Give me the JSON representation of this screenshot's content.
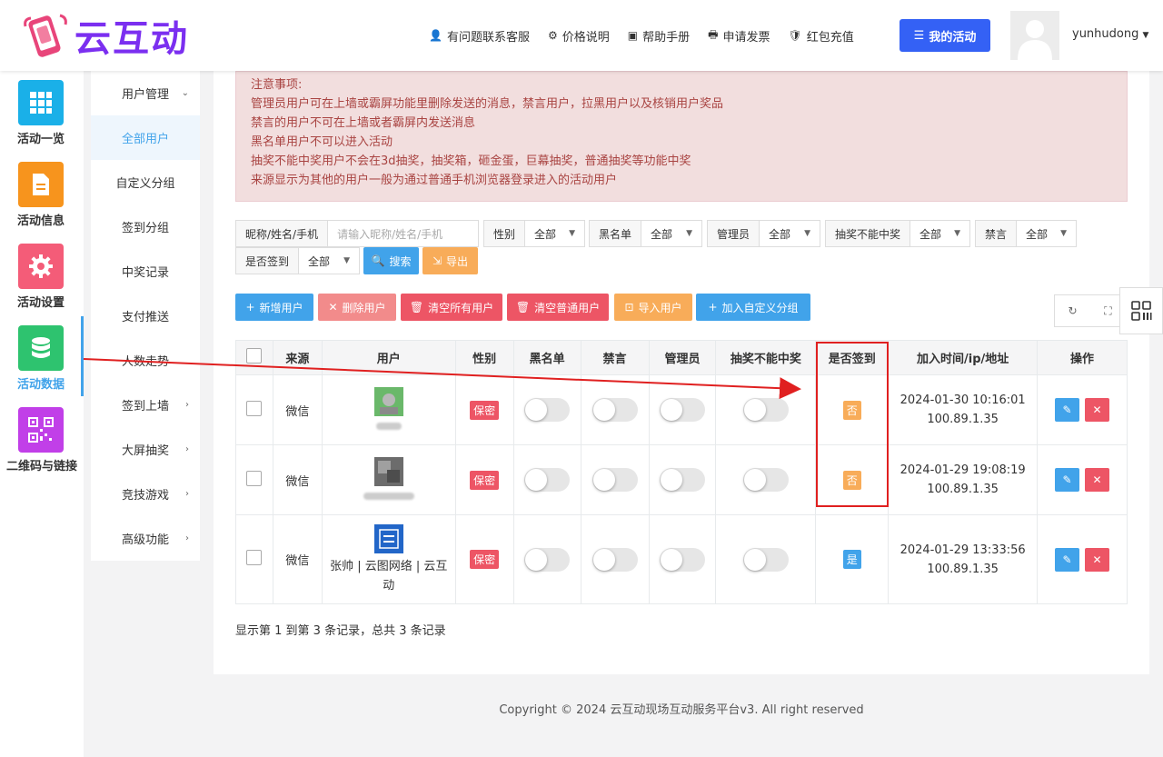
{
  "brand": {
    "name": "云互动"
  },
  "topnav": [
    {
      "icon": "user-plus-icon",
      "label": "有问题联系客服"
    },
    {
      "icon": "gear-icon",
      "label": "价格说明"
    },
    {
      "icon": "book-icon",
      "label": "帮助手册"
    },
    {
      "icon": "printer-icon",
      "label": "申请发票"
    },
    {
      "icon": "shield-check-icon",
      "label": "红包充值"
    }
  ],
  "my_activity": "我的活动",
  "username": "yunhudong",
  "leftbar": [
    {
      "label": "活动一览",
      "icon": "grid-icon",
      "color": "#1ab0e8"
    },
    {
      "label": "活动信息",
      "icon": "document-icon",
      "color": "#f7941d"
    },
    {
      "label": "活动设置",
      "icon": "gear-icon",
      "color": "#f45c78"
    },
    {
      "label": "活动数据",
      "icon": "database-icon",
      "color": "#2ec36f"
    },
    {
      "label": "二维码与链接",
      "icon": "qrcode-icon",
      "color": "#c13fe8"
    }
  ],
  "subnav": [
    {
      "label": "用户管理",
      "chev": "⌄"
    },
    {
      "label": "全部用户",
      "chev": ""
    },
    {
      "label": "自定义分组",
      "chev": ""
    },
    {
      "label": "签到分组",
      "chev": ""
    },
    {
      "label": "中奖记录",
      "chev": ""
    },
    {
      "label": "支付推送",
      "chev": ""
    },
    {
      "label": "人数走势",
      "chev": ""
    },
    {
      "label": "签到上墙",
      "chev": "›"
    },
    {
      "label": "大屏抽奖",
      "chev": "›"
    },
    {
      "label": "竞技游戏",
      "chev": "›"
    },
    {
      "label": "高级功能",
      "chev": "›"
    }
  ],
  "notice": [
    "注意事项:",
    "管理员用户可在上墙或霸屏功能里删除发送的消息，禁言用户，拉黑用户以及核销用户奖品",
    "禁言的用户不可在上墙或者霸屏内发送消息",
    "黑名单用户不可以进入活动",
    "抽奖不能中奖用户不会在3d抽奖，抽奖箱，砸金蛋，巨幕抽奖，普通抽奖等功能中奖",
    "来源显示为其他的用户一般为通过普通手机浏览器登录进入的活动用户"
  ],
  "filters": {
    "search_label": "昵称/姓名/手机",
    "search_placeholder": "请输入昵称/姓名/手机",
    "gender_label": "性别",
    "blacklist_label": "黑名单",
    "admin_label": "管理员",
    "nowin_label": "抽奖不能中奖",
    "mute_label": "禁言",
    "signed_label": "是否签到",
    "all": "全部",
    "search_btn": "搜索",
    "export_btn": "导出"
  },
  "actions": {
    "add": "新增用户",
    "delete": "删除用户",
    "clear_all": "清空所有用户",
    "clear_normal": "清空普通用户",
    "import": "导入用户",
    "add_group": "加入自定义分组"
  },
  "table": {
    "headers": [
      "来源",
      "用户",
      "性别",
      "黑名单",
      "禁言",
      "管理员",
      "抽奖不能中奖",
      "是否签到",
      "加入时间/ip/地址",
      "操作"
    ],
    "rows": [
      {
        "source": "微信",
        "name": "",
        "gender": "保密",
        "signed": "否",
        "time": "2024-01-30 10:16:01",
        "ip": "100.89.1.35"
      },
      {
        "source": "微信",
        "name": "",
        "gender": "保密",
        "signed": "否",
        "time": "2024-01-29 19:08:19",
        "ip": "100.89.1.35"
      },
      {
        "source": "微信",
        "name": "张帅 | 云图网络 | 云互动",
        "gender": "保密",
        "signed": "是",
        "time": "2024-01-29 13:33:56",
        "ip": "100.89.1.35"
      }
    ]
  },
  "summary": "显示第 1 到第 3 条记录，总共 3 条记录",
  "footer": "Copyright © 2024 云互动现场互动服务平台v3. All right reserved"
}
